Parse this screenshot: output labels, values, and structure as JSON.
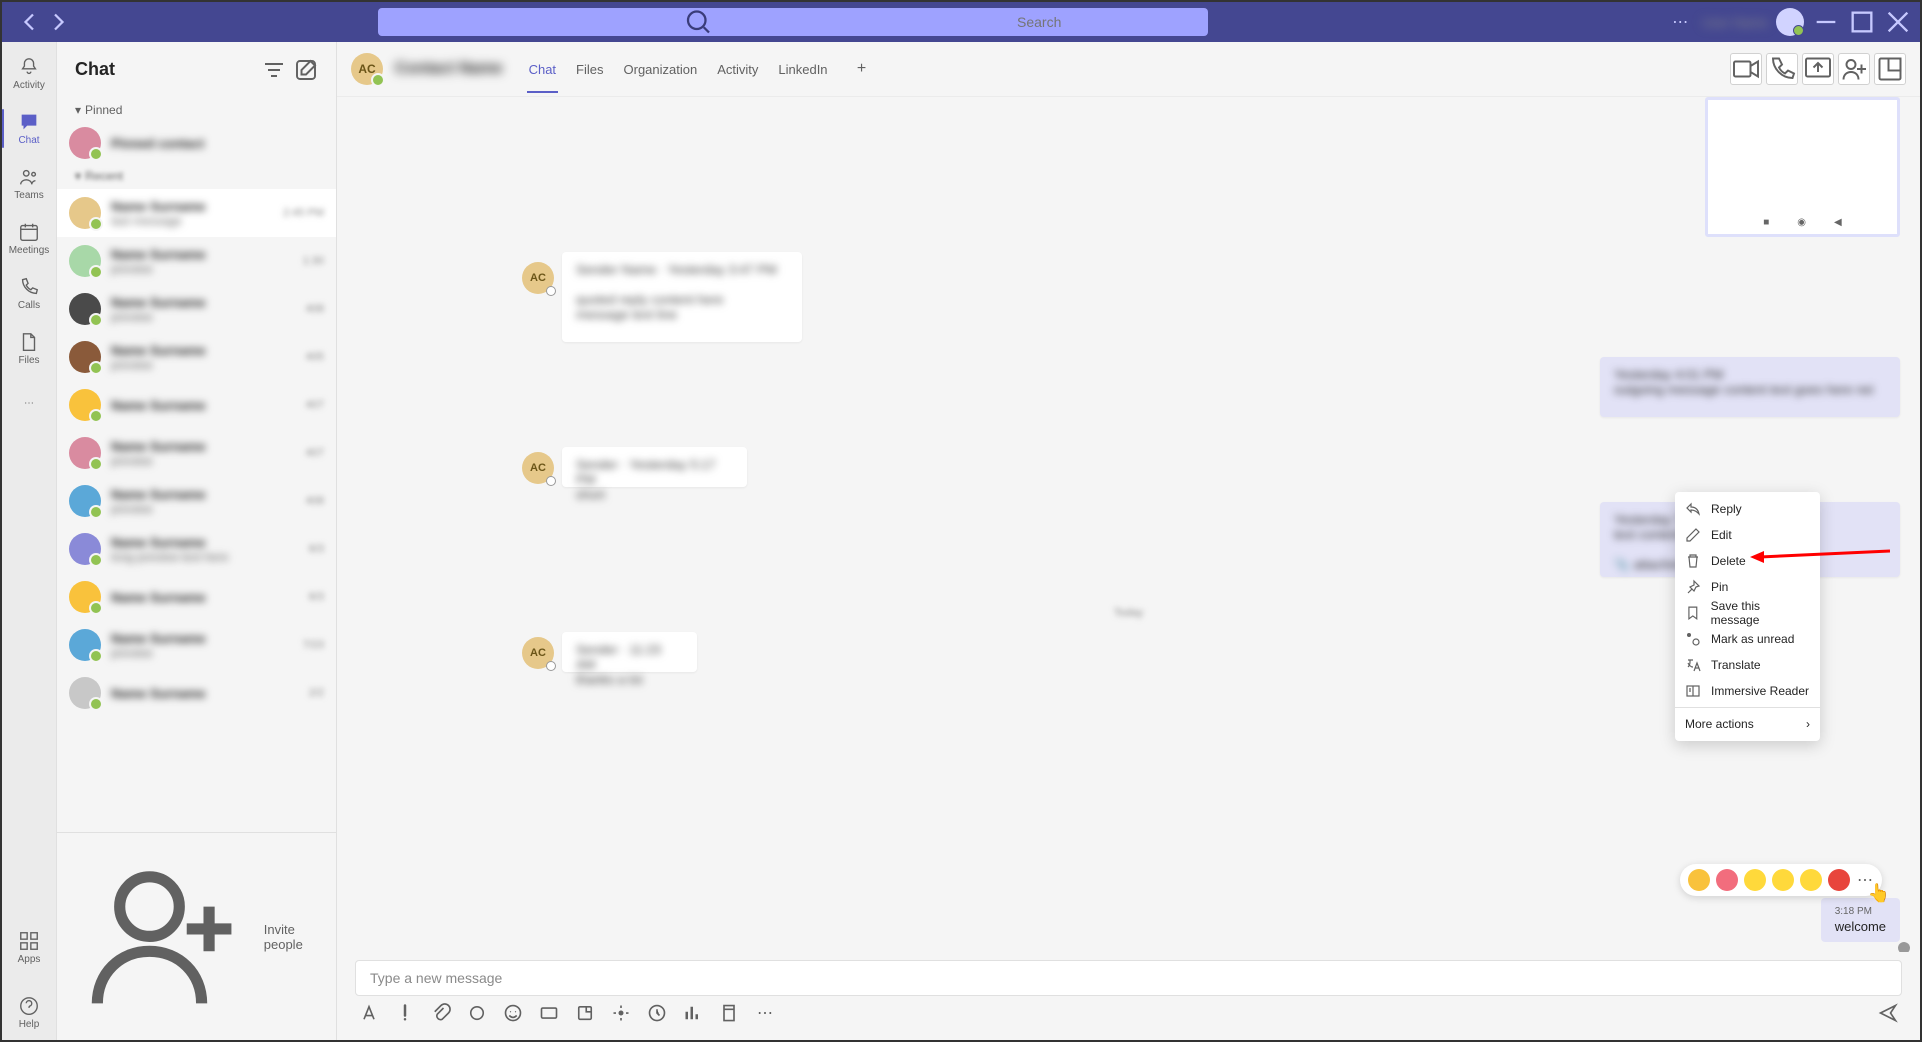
{
  "search": {
    "placeholder": "Search"
  },
  "titlebar": {
    "username": "User Name"
  },
  "rail": {
    "items": [
      {
        "label": "Activity"
      },
      {
        "label": "Chat"
      },
      {
        "label": "Teams"
      },
      {
        "label": "Meetings"
      },
      {
        "label": "Calls"
      },
      {
        "label": "Files"
      }
    ],
    "apps": "Apps",
    "help": "Help"
  },
  "chat_list": {
    "title": "Chat",
    "pinned_label": "Pinned",
    "invite": "Invite people"
  },
  "chat_header": {
    "avatar_initials": "AC",
    "name": "Contact Name",
    "tabs": [
      "Chat",
      "Files",
      "Organization",
      "Activity",
      "LinkedIn"
    ]
  },
  "context_menu": {
    "reply": "Reply",
    "edit": "Edit",
    "delete": "Delete",
    "pin": "Pin",
    "save": "Save this message",
    "mark_unread": "Mark as unread",
    "translate": "Translate",
    "immersive": "Immersive Reader",
    "more": "More actions"
  },
  "welcome": {
    "time": "3:18 PM",
    "text": "welcome"
  },
  "compose": {
    "placeholder": "Type a new message"
  },
  "msg_avatar": "AC"
}
